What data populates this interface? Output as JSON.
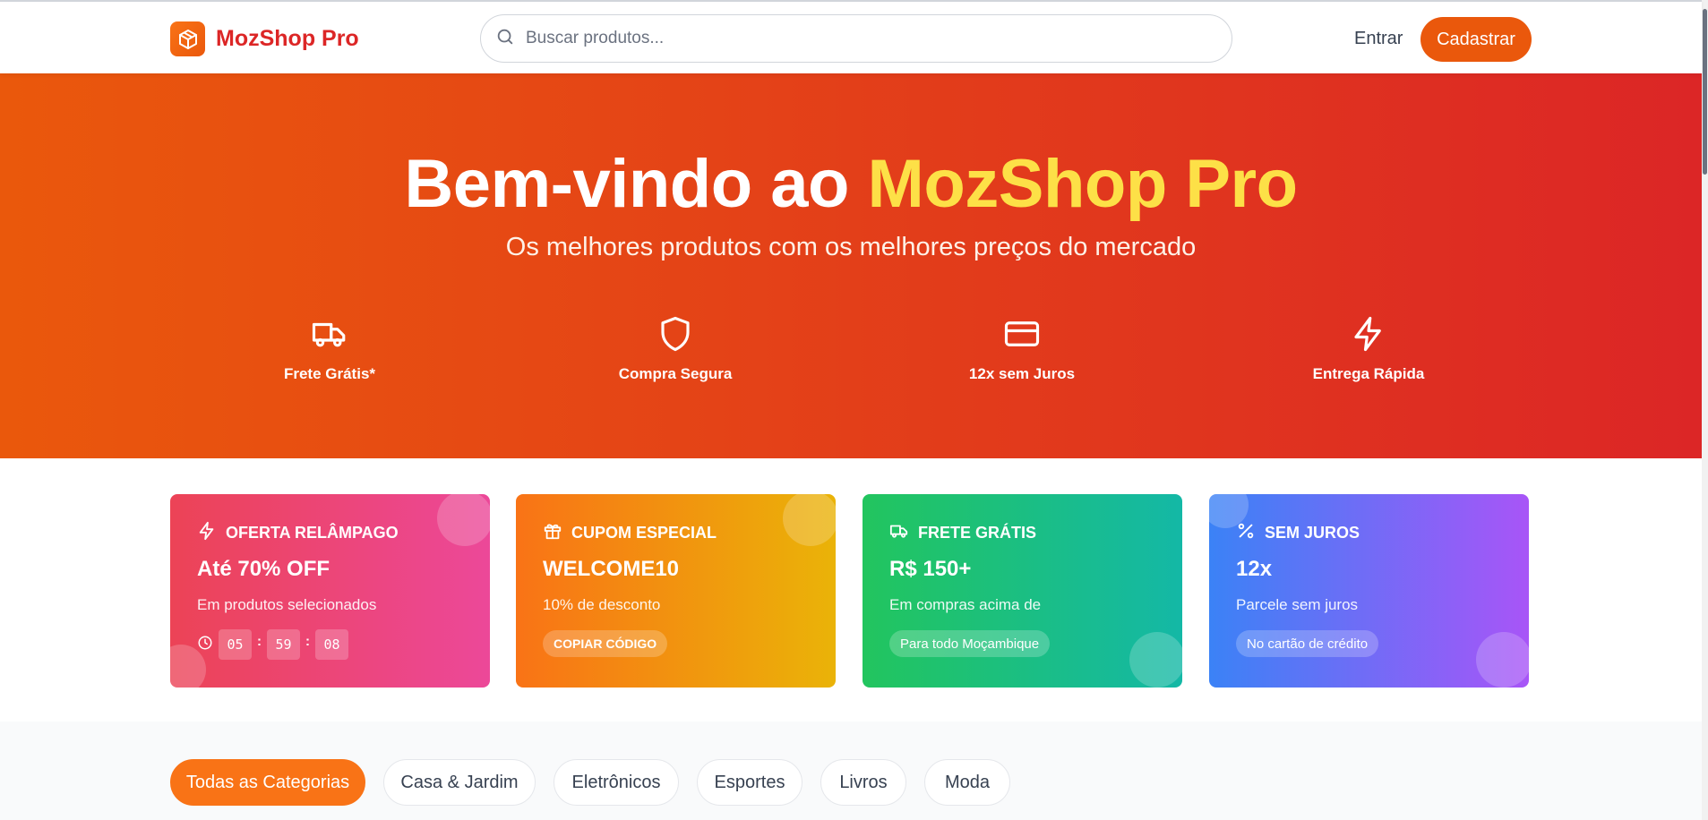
{
  "header": {
    "logo_text": "MozShop Pro",
    "search_placeholder": "Buscar produtos...",
    "login_label": "Entrar",
    "signup_label": "Cadastrar"
  },
  "hero": {
    "title_prefix": "Bem-vindo ao ",
    "title_brand": "MozShop Pro",
    "subtitle": "Os melhores produtos com os melhores preços do mercado",
    "features": [
      {
        "icon": "truck-icon",
        "label": "Frete Grátis*"
      },
      {
        "icon": "shield-icon",
        "label": "Compra Segura"
      },
      {
        "icon": "credit-card-icon",
        "label": "12x sem Juros"
      },
      {
        "icon": "lightning-icon",
        "label": "Entrega Rápida"
      }
    ]
  },
  "promos": [
    {
      "icon": "lightning-icon",
      "heading": "OFERTA RELÂMPAGO",
      "big": "Até 70% OFF",
      "desc": "Em produtos selecionados",
      "timer": [
        "05",
        "59",
        "08"
      ]
    },
    {
      "icon": "gift-icon",
      "heading": "CUPOM ESPECIAL",
      "big": "WELCOME10",
      "desc": "10% de desconto",
      "badge": "COPIAR CÓDIGO"
    },
    {
      "icon": "truck-icon",
      "heading": "FRETE GRÁTIS",
      "big": "R$ 150+",
      "desc": "Em compras acima de",
      "badge": "Para todo Moçambique"
    },
    {
      "icon": "percent-icon",
      "heading": "SEM JUROS",
      "big": "12x",
      "desc": "Parcele sem juros",
      "badge": "No cartão de crédito"
    }
  ],
  "categories": [
    "Todas as Categorias",
    "Casa & Jardim",
    "Eletrônicos",
    "Esportes",
    "Livros",
    "Moda"
  ],
  "active_category": "Todas as Categorias",
  "colors": {
    "brand_orange": "#ea580c",
    "brand_red": "#dc2626",
    "accent_yellow": "#fde047"
  }
}
